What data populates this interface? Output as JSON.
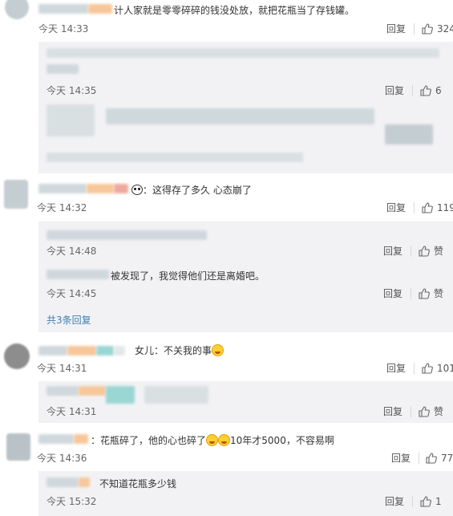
{
  "reply_label": "回复",
  "like_label": "赞",
  "comments": [
    {
      "text": "计人家就是零零碎碎的钱没处放，就把花瓶当了存钱罐。",
      "time": "今天 14:33",
      "likes": "324"
    },
    {
      "time": "今天 14:35",
      "likes": "6"
    },
    {
      "text": "：这得存了多久  心态崩了",
      "time": "今天 14:32",
      "likes": "119"
    },
    {
      "time": "今天 14:48"
    },
    {
      "text": "被发现了，我觉得他们还是离婚吧。",
      "time": "今天 14:45"
    },
    {
      "expand": "共3条回复"
    },
    {
      "text_prefix": "女儿：不关我的事",
      "time": "今天 14:31",
      "likes": "101"
    },
    {
      "time": "今天 14:31"
    },
    {
      "text_prefix": "：花瓶碎了，他的心也碎了",
      "text_suffix": "10年才5000，不容易啊",
      "time": "今天 14:36",
      "likes": "77"
    },
    {
      "text": "不知道花瓶多少钱",
      "time": "今天 15:32",
      "likes": "1"
    }
  ]
}
